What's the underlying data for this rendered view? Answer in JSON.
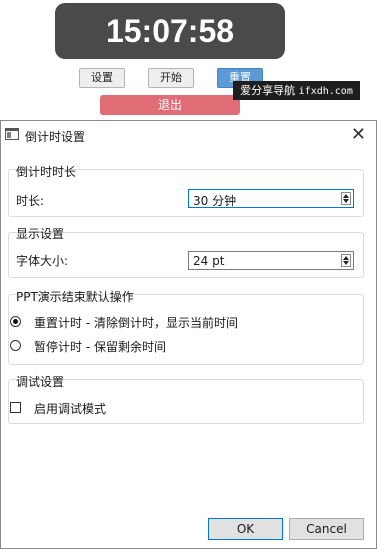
{
  "timer": {
    "display": "15:07:58"
  },
  "toolbar": {
    "settings_label": "设置",
    "start_label": "开始",
    "reset_label": "重置",
    "exit_label": "退出"
  },
  "watermark": {
    "text": "爱分享导航",
    "url": "ifxdh.com"
  },
  "dialog": {
    "title": "倒计时设置",
    "close_glyph": "✕",
    "countdown": {
      "group_title": "倒计时时长",
      "duration_label": "时长:",
      "duration_value": "30 分钟"
    },
    "display": {
      "group_title": "显示设置",
      "font_size_label": "字体大小:",
      "font_size_value": "24 pt"
    },
    "ppt": {
      "group_title": "PPT演示结束默认操作",
      "options": [
        {
          "label": "重置计时 - 清除倒计时，显示当前时间",
          "selected": true
        },
        {
          "label": "暂停计时 - 保留剩余时间",
          "selected": false
        }
      ]
    },
    "debug": {
      "group_title": "调试设置",
      "debug_mode_label": "启用调试模式",
      "debug_mode_checked": false
    },
    "ok_label": "OK",
    "cancel_label": "Cancel"
  },
  "icons": {
    "spin_up": "triangle-up-icon",
    "spin_down": "triangle-down-icon",
    "close": "close-icon",
    "app": "window-app-icon"
  },
  "colors": {
    "timer_bg": "#4a4a4a",
    "exit_button": "#e06c75",
    "reset_button": "#5b9bd5",
    "focus_border": "#0078d7"
  }
}
